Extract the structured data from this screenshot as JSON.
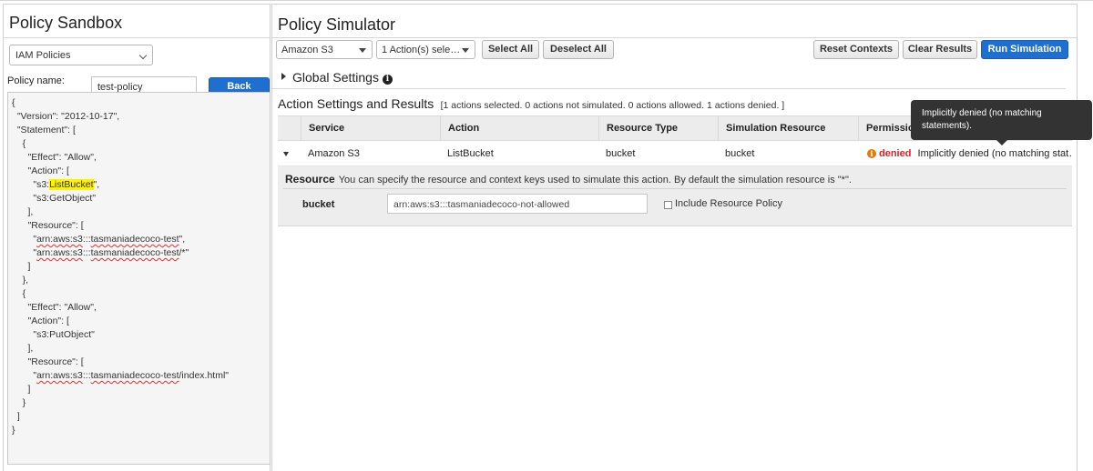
{
  "sandbox": {
    "title": "Policy Sandbox",
    "policy_type": "IAM Policies",
    "policy_name_label": "Policy name:",
    "policy_name_value": "test-policy",
    "back_label": "Back",
    "code_lines": [
      "{",
      "  \"Version\": \"2012-10-17\",",
      "  \"Statement\": [",
      "    {",
      "      \"Effect\": \"Allow\",",
      "      \"Action\": [",
      "        \"s3:ListBucket\",",
      "        \"s3:GetObject\"",
      "      ],",
      "      \"Resource\": [",
      "        \"arn:aws:s3:::tasmaniadecoco-test\",",
      "        \"arn:aws:s3:::tasmaniadecoco-test/*\"",
      "      ]",
      "    },",
      "    {",
      "      \"Effect\": \"Allow\",",
      "      \"Action\": [",
      "        \"s3:PutObject\"",
      "      ],",
      "      \"Resource\": [",
      "        \"arn:aws:s3:::tasmaniadecoco-test/index.html\"",
      "      ]",
      "    }",
      "  ]",
      "}"
    ],
    "code_special": {
      "line6_pre": "        \"s3:",
      "line6_hl": "ListBucket",
      "line6_post": "\",",
      "arn_prefix": "arn:aws:s3",
      "bucket_name": "tasmaniadecoco-test",
      "line10_pre": "        \"",
      "line10_post": "\",",
      "line11_post": "/*\"",
      "line20_post": "/index.html\""
    }
  },
  "simulator": {
    "title": "Policy Simulator",
    "service_select": "Amazon S3",
    "actions_select": "1 Action(s) sele…",
    "buttons": {
      "select_all": "Select All",
      "deselect_all": "Deselect All",
      "reset_contexts": "Reset Contexts",
      "clear_results": "Clear Results",
      "run_simulation": "Run Simulation"
    },
    "global_settings": "Global Settings",
    "action_settings_title": "Action Settings and Results",
    "action_summary": "[1 actions selected. 0 actions not simulated. 0 actions allowed. 1 actions denied. ]",
    "columns": [
      "Service",
      "Action",
      "Resource Type",
      "Simulation Resource",
      "Permission"
    ],
    "row": {
      "service": "Amazon S3",
      "action": "ListBucket",
      "resource_type": "bucket",
      "simulation_resource": "bucket",
      "permission": "denied",
      "permission_detail": "Implicitly denied (no matching stat…"
    },
    "resource_detail": {
      "title": "Resource",
      "description": "You can specify the resource and context keys used to simulate this action. By default the simulation resource is \"*\".",
      "bucket_label": "bucket",
      "arn_value": "arn:aws:s3:::tasmaniadecoco-not-allowed",
      "include_policy_label": "Include Resource Policy",
      "include_policy_checked": false
    },
    "tooltip": "Implicitly denied (no matching statements)."
  },
  "colors": {
    "primary_button": "#1f6fd1",
    "denied": "#d1242a",
    "warning_icon": "#e07c0a",
    "highlight": "#fff200"
  }
}
